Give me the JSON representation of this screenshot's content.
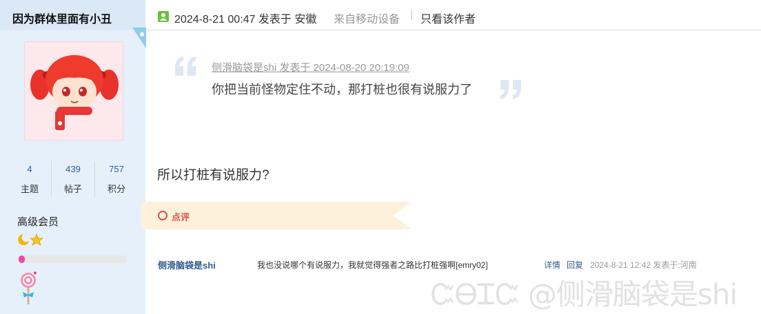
{
  "author": {
    "name": "因为群体里面有小丑",
    "stats": [
      {
        "value": "4",
        "label": "主题"
      },
      {
        "value": "439",
        "label": "帖子"
      },
      {
        "value": "757",
        "label": "积分"
      }
    ],
    "rank": "高级会员",
    "level_progress": 0.06
  },
  "post": {
    "date": "2024-8-21 00:47 发表于 安徽",
    "from": "来自移动设备",
    "separator": "|",
    "only_author": "只看该作者",
    "quote_meta": "侧滑脑袋是shi 发表于 2024-08-20 20:19:09",
    "quote_text": "你把当前怪物定住不动，那打桩也很有说服力了",
    "body": "所以打桩有说服力?"
  },
  "comments": {
    "label": "点评",
    "items": [
      {
        "user": "侧滑脑袋是shi",
        "text": "我也没说哪个有说服力，我就觉得强者之路比打桩强啊[emry02]",
        "detail": "详情",
        "reply": "回复",
        "time": "2024-8-21 12:42 发表于:河南"
      }
    ]
  },
  "watermark": "ᏨᎾᏆᏨ @侧滑脑袋是shi",
  "colors": {
    "sidebar_bg": "#e5f0fb",
    "link": "#355d89",
    "accent_red": "#d9534f",
    "ribbon": "#fdf1dc"
  }
}
